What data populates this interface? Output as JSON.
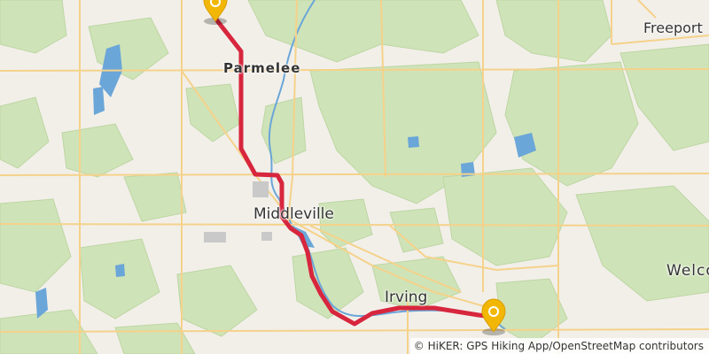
{
  "map": {
    "labels": {
      "parmelee": "Parmelee",
      "middleville": "Middleville",
      "irving": "Irving",
      "freeport": "Freeport",
      "welcome": "Welco"
    },
    "attribution": "© HiKER: GPS Hiking App/OpenStreetMap contributors",
    "colors": {
      "land": "#f2efe9",
      "forest": "#cfe3b8",
      "water": "#6aa6d8",
      "road": "#f5d28a",
      "route": "#d7263d",
      "marker": "#f2b705"
    },
    "markers": [
      {
        "name": "start",
        "icon": "pin-marker-icon"
      },
      {
        "name": "end",
        "icon": "pin-marker-icon"
      }
    ]
  }
}
